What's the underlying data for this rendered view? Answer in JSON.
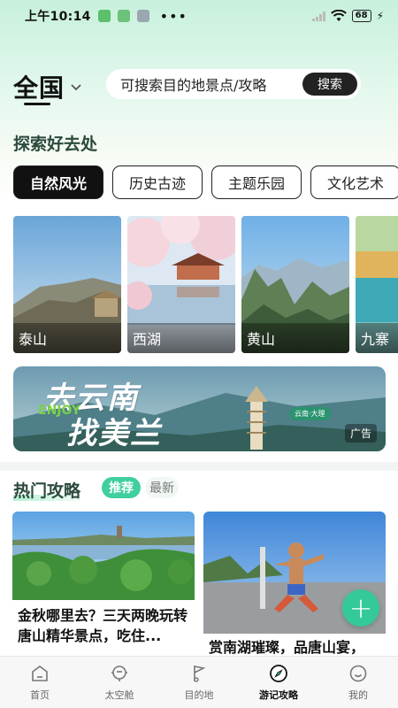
{
  "status_bar": {
    "time": "上午10:14",
    "battery": "68"
  },
  "header": {
    "location": "全国",
    "search_placeholder": "可搜索目的地景点/攻略",
    "search_button": "搜索"
  },
  "explore": {
    "title": "探索好去处",
    "categories": [
      {
        "label": "自然风光",
        "active": true
      },
      {
        "label": "历史古迹",
        "active": false
      },
      {
        "label": "主题乐园",
        "active": false
      },
      {
        "label": "文化艺术",
        "active": false
      }
    ],
    "places": [
      {
        "name": "泰山"
      },
      {
        "name": "西湖"
      },
      {
        "name": "黄山"
      },
      {
        "name": "九寨"
      }
    ]
  },
  "ad": {
    "title_line1": "去云南",
    "title_line2": "找美兰",
    "enjoy": "ENJOY",
    "pin": "云南·大理",
    "tag": "广告"
  },
  "hot": {
    "title": "热门攻略",
    "tabs": [
      {
        "label": "推荐",
        "active": true
      },
      {
        "label": "最新",
        "active": false
      }
    ],
    "cards": [
      {
        "title": "金秋哪里去？三天两晚玩转唐山精华景点，吃住..."
      },
      {
        "title": "赏南湖璀璨，品唐山宴，"
      }
    ]
  },
  "tabbar": {
    "items": [
      {
        "label": "首页",
        "icon": "home-icon",
        "active": false
      },
      {
        "label": "太空舱",
        "icon": "capsule-icon",
        "active": false
      },
      {
        "label": "目的地",
        "icon": "flag-icon",
        "active": false
      },
      {
        "label": "游记攻略",
        "icon": "compass-icon",
        "active": true
      },
      {
        "label": "我的",
        "icon": "smile-icon",
        "active": false
      }
    ]
  },
  "colors": {
    "accent": "#33c99b",
    "dark": "#111111"
  }
}
